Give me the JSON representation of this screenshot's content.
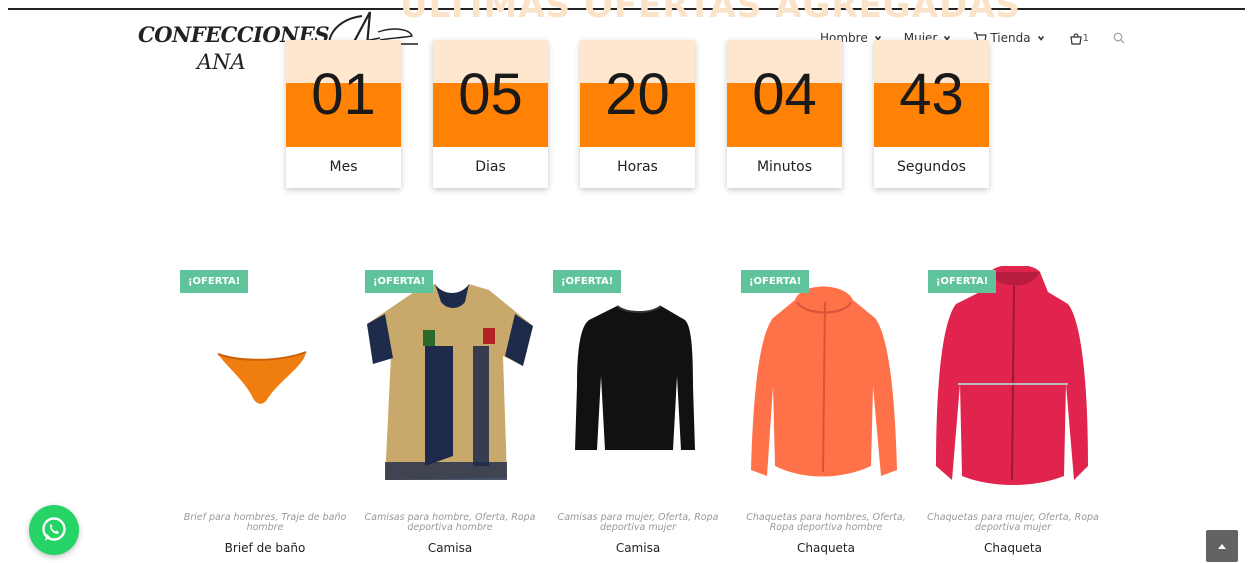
{
  "page": {
    "faded_title": "ÚLTIMAS OFERTAS AGREGADAS"
  },
  "logo": {
    "line1": "CONFECCIONES",
    "line2": "ANA"
  },
  "nav": {
    "items": [
      {
        "label": "Hombre",
        "icon": "chevron-down-icon"
      },
      {
        "label": "Mujer",
        "icon": "chevron-down-icon"
      },
      {
        "label": "Tienda",
        "icon": "cart-icon"
      }
    ],
    "cart_count": "1",
    "search_icon": "search-icon"
  },
  "countdown": [
    {
      "value": "01",
      "label": "Mes"
    },
    {
      "value": "05",
      "label": "Dias"
    },
    {
      "value": "20",
      "label": "Horas"
    },
    {
      "value": "04",
      "label": "Minutos"
    },
    {
      "value": "43",
      "label": "Segundos"
    }
  ],
  "products": [
    {
      "badge": "¡OFERTA!",
      "categories": "Brief para hombres, Traje de baño hombre",
      "name": "Brief de baño",
      "image": "orange-swim-brief"
    },
    {
      "badge": "¡OFERTA!",
      "categories": "Camisas para hombre, Oferta, Ropa deportiva hombre",
      "name": "Camisa",
      "image": "gold-black-jersey"
    },
    {
      "badge": "¡OFERTA!",
      "categories": "Camisas para mujer, Oferta, Ropa deportiva mujer",
      "name": "Camisa",
      "image": "black-long-sleeve-shirt"
    },
    {
      "badge": "¡OFERTA!",
      "categories": "Chaquetas para hombres, Oferta, Ropa deportiva hombre",
      "name": "Chaqueta",
      "image": "coral-hooded-jacket"
    },
    {
      "badge": "¡OFERTA!",
      "categories": "Chaquetas para mujer, Oferta, Ropa deportiva mujer",
      "name": "Chaqueta",
      "image": "pink-hooded-jacket"
    }
  ],
  "colors": {
    "accent_orange": "#ff8205",
    "badge_green": "#5fc49b",
    "whatsapp_green": "#25d366"
  },
  "widgets": {
    "whatsapp_icon": "whatsapp-icon",
    "scroll_top_icon": "arrow-up-icon"
  }
}
